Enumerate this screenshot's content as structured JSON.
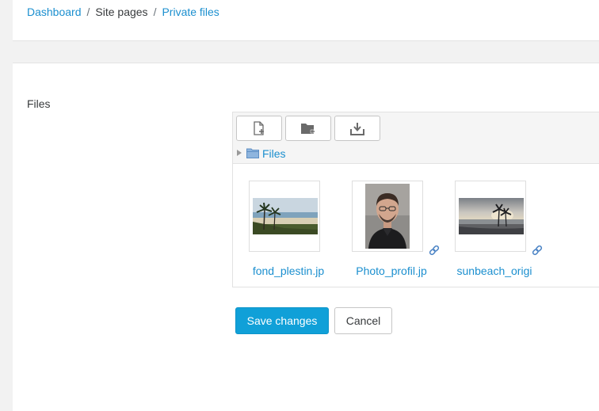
{
  "breadcrumb": {
    "items": [
      "Dashboard",
      "Site pages",
      "Private files"
    ],
    "separator": "/"
  },
  "form": {
    "field_label": "Files"
  },
  "filemanager": {
    "toolbar": {
      "add_file_icon": "add-file-icon",
      "create_folder_icon": "create-folder-icon",
      "download_icon": "download-icon"
    },
    "path_label": "Files",
    "files": [
      {
        "name": "fond_plestin.jp",
        "thumbnail": "beach-palms-landscape",
        "is_alias": false
      },
      {
        "name": "Photo_profil.jp",
        "thumbnail": "portrait-photo",
        "is_alias": true
      },
      {
        "name": "sunbeach_origi",
        "thumbnail": "sunset-palms",
        "is_alias": true
      }
    ]
  },
  "buttons": {
    "save": "Save changes",
    "cancel": "Cancel"
  },
  "colors": {
    "link": "#1b8fcf",
    "primary_button": "#10a0d8",
    "page_background": "#f2f2f2"
  }
}
